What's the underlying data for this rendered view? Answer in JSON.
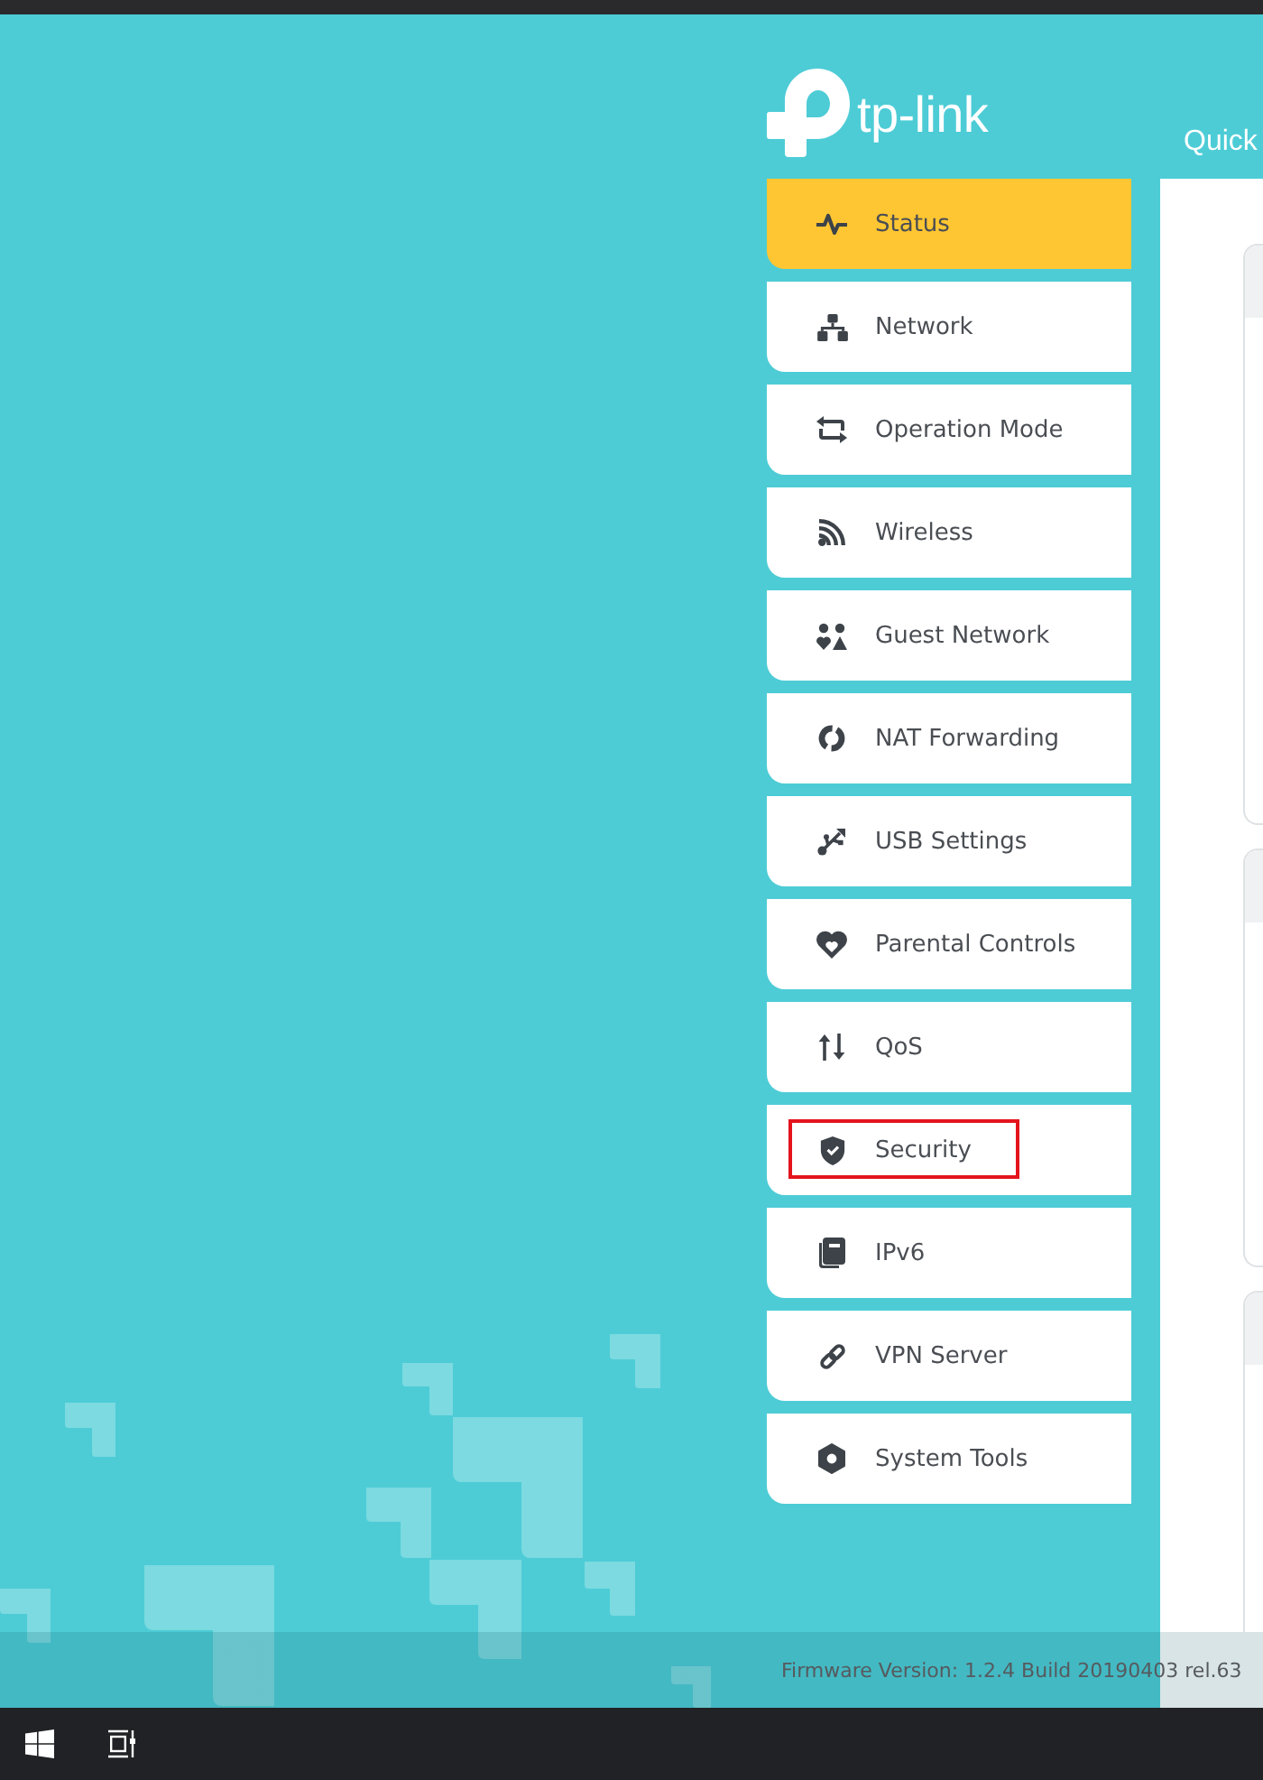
{
  "header": {
    "logo_text": "tp-link",
    "page_title": "Quick"
  },
  "menu": {
    "items": [
      {
        "label": "Status",
        "selected": true,
        "highlighted": false
      },
      {
        "label": "Network",
        "selected": false,
        "highlighted": false
      },
      {
        "label": "Operation Mode",
        "selected": false,
        "highlighted": false
      },
      {
        "label": "Wireless",
        "selected": false,
        "highlighted": false
      },
      {
        "label": "Guest Network",
        "selected": false,
        "highlighted": false
      },
      {
        "label": "NAT Forwarding",
        "selected": false,
        "highlighted": false
      },
      {
        "label": "USB Settings",
        "selected": false,
        "highlighted": false
      },
      {
        "label": "Parental Controls",
        "selected": false,
        "highlighted": false
      },
      {
        "label": "QoS",
        "selected": false,
        "highlighted": false
      },
      {
        "label": "Security",
        "selected": false,
        "highlighted": true
      },
      {
        "label": "IPv6",
        "selected": false,
        "highlighted": false
      },
      {
        "label": "VPN Server",
        "selected": false,
        "highlighted": false
      },
      {
        "label": "System Tools",
        "selected": false,
        "highlighted": false
      }
    ]
  },
  "footer": {
    "firmware_version": "Firmware Version: 1.2.4 Build 20190403 rel.63"
  }
}
